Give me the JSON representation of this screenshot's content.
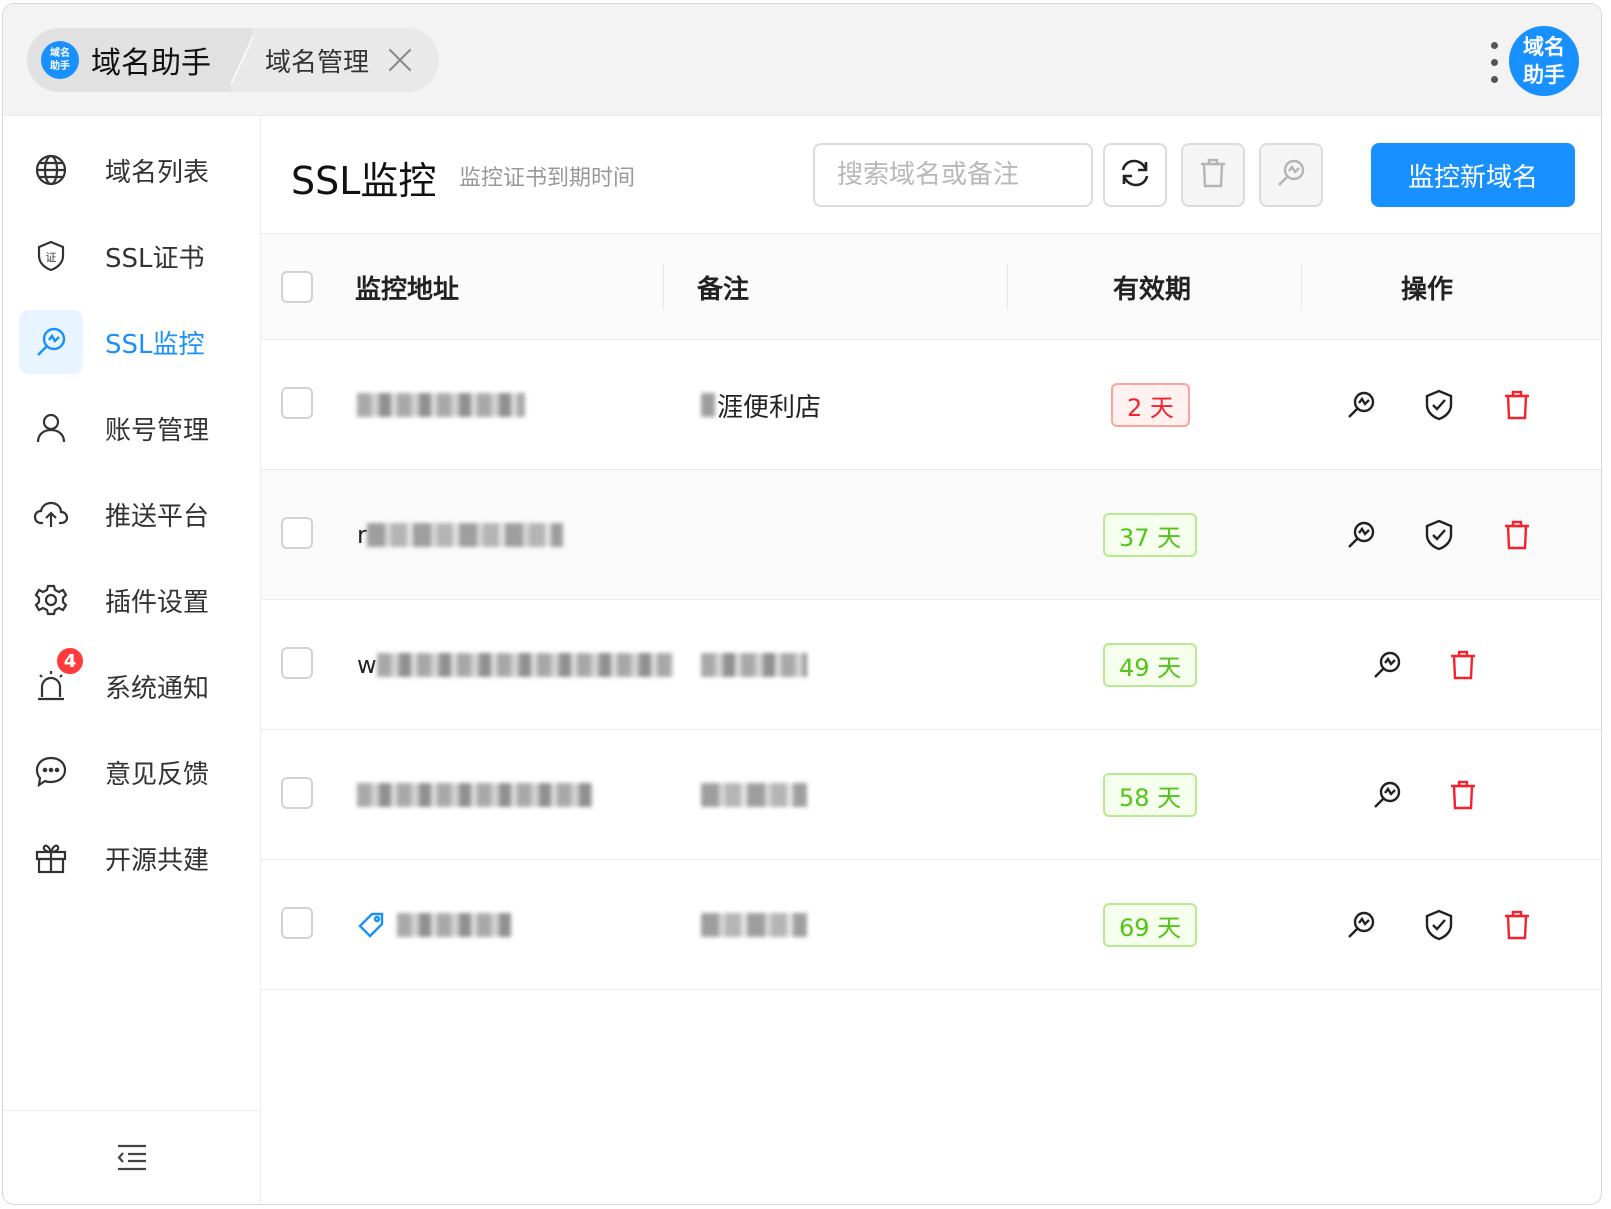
{
  "app": {
    "logo_text": "域名助手",
    "home_tab_label": "域名助手",
    "active_tab_label": "域名管理",
    "avatar_text": "域名助手"
  },
  "sidebar": {
    "items": [
      {
        "label": "域名列表",
        "icon": "globe-icon"
      },
      {
        "label": "SSL证书",
        "icon": "certificate-shield-icon"
      },
      {
        "label": "SSL监控",
        "icon": "monitor-search-icon",
        "active": true
      },
      {
        "label": "账号管理",
        "icon": "user-icon"
      },
      {
        "label": "推送平台",
        "icon": "cloud-upload-icon"
      },
      {
        "label": "插件设置",
        "icon": "gear-icon"
      },
      {
        "label": "系统通知",
        "icon": "alarm-icon",
        "badge": "4"
      },
      {
        "label": "意见反馈",
        "icon": "chat-bubble-icon"
      },
      {
        "label": "开源共建",
        "icon": "gift-icon"
      }
    ],
    "collapse_icon": "menu-fold-icon"
  },
  "page": {
    "title": "SSL监控",
    "subtitle": "监控证书到期时间",
    "search_placeholder": "搜索域名或备注",
    "add_button_label": "监控新域名"
  },
  "table": {
    "columns": [
      "监控地址",
      "备注",
      "有效期",
      "操作"
    ],
    "rows": [
      {
        "url_prefix": "",
        "note_visible": "涯便利店",
        "days": "2 天",
        "status": "danger",
        "actions": [
          "monitor",
          "cert",
          "delete"
        ]
      },
      {
        "url_prefix": "r",
        "note_visible": "",
        "days": "37 天",
        "status": "ok",
        "actions": [
          "monitor",
          "cert",
          "delete"
        ]
      },
      {
        "url_prefix": "w",
        "note_visible": "",
        "days": "49 天",
        "status": "ok",
        "actions": [
          "monitor",
          "delete"
        ]
      },
      {
        "url_prefix": "",
        "note_visible": "",
        "days": "58 天",
        "status": "ok",
        "actions": [
          "monitor",
          "delete"
        ]
      },
      {
        "url_prefix": "",
        "note_visible": "",
        "days": "69 天",
        "status": "ok",
        "has_tag_icon": true,
        "actions": [
          "monitor",
          "cert",
          "delete"
        ]
      }
    ]
  },
  "colors": {
    "primary": "#1890ff",
    "danger": "#f5222d",
    "success": "#52c41a"
  }
}
